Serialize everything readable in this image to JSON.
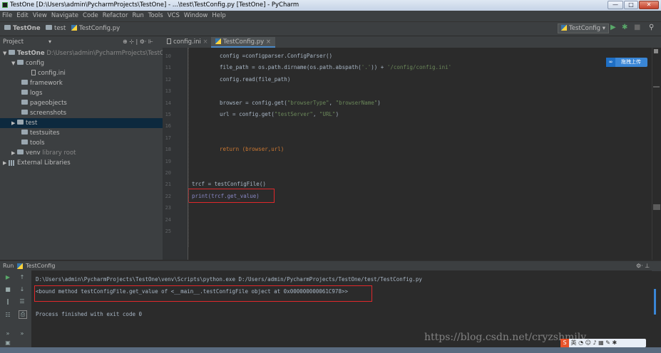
{
  "window": {
    "title": "TestOne [D:\\Users\\admin\\PycharmProjects\\TestOne] - ...\\test\\TestConfig.py [TestOne] - PyCharm",
    "min_label": "—",
    "max_label": "□",
    "close_label": "✕"
  },
  "menu": [
    "File",
    "Edit",
    "View",
    "Navigate",
    "Code",
    "Refactor",
    "Run",
    "Tools",
    "VCS",
    "Window",
    "Help"
  ],
  "navbar": {
    "crumbs": [
      "TestOne",
      "test",
      "TestConfig.py"
    ],
    "run_config": "TestConfig ▾",
    "run_icon": "▶",
    "debug_icon": "✱",
    "stop_icon": "■",
    "search_icon": "⚲"
  },
  "project_panel": {
    "title": "Project",
    "dropdown_icon": "▾",
    "tool_icons": "⊕ ⊹ | ⚙· ⊩",
    "tree": [
      {
        "label": "TestOne",
        "extra": "D:\\Users\\admin\\PycharmProjects\\TestOne",
        "arrow": "▼",
        "kind": "folder"
      },
      {
        "label": "config",
        "extra": "",
        "arrow": "▼",
        "kind": "folder"
      },
      {
        "label": "config.ini",
        "extra": "",
        "arrow": "",
        "kind": "ini"
      },
      {
        "label": "framework",
        "extra": "",
        "arrow": "",
        "kind": "folder"
      },
      {
        "label": "logs",
        "extra": "",
        "arrow": "",
        "kind": "folder"
      },
      {
        "label": "pageobjects",
        "extra": "",
        "arrow": "",
        "kind": "folder"
      },
      {
        "label": "screenshots",
        "extra": "",
        "arrow": "",
        "kind": "folder"
      },
      {
        "label": "test",
        "extra": "",
        "arrow": "▶",
        "kind": "folder"
      },
      {
        "label": "testsuites",
        "extra": "",
        "arrow": "",
        "kind": "folder"
      },
      {
        "label": "tools",
        "extra": "",
        "arrow": "",
        "kind": "folder"
      },
      {
        "label": "venv",
        "extra": "library root",
        "arrow": "▶",
        "kind": "folder"
      },
      {
        "label": "External Libraries",
        "extra": "",
        "arrow": "▶",
        "kind": "lib"
      }
    ]
  },
  "tabs": [
    {
      "label": "config.ini",
      "close": "×",
      "active": false
    },
    {
      "label": "TestConfig.py",
      "close": "×",
      "active": true
    }
  ],
  "editor": {
    "line_numbers": [
      "10",
      "11",
      "12",
      "13",
      "14",
      "15",
      "16",
      "17",
      "18",
      "19",
      "20",
      "21",
      "22",
      "23",
      "24",
      "25"
    ],
    "lines": [
      {
        "text": "config =configparser.ConfigParser()"
      },
      {
        "text": "file_path = os.path.dirname(os.path.abspath('.')) + '/config/config.ini'"
      },
      {
        "text": "config.read(file_path)"
      },
      {
        "text": ""
      },
      {
        "text": "browser = config.get(\"browserType\", \"browserName\")"
      },
      {
        "text": "url = config.get(\"testServer\", \"URL\")"
      },
      {
        "text": ""
      },
      {
        "text": ""
      },
      {
        "text": "return (browser,url)"
      },
      {
        "text": ""
      },
      {
        "text": ""
      },
      {
        "text": "trcf = testConfigFile()"
      },
      {
        "text": "print(trcf.get_value)"
      },
      {
        "text": ""
      },
      {
        "text": ""
      },
      {
        "text": ""
      }
    ],
    "cloud_button": "拖拽上传"
  },
  "run_panel": {
    "title": "Run",
    "config": "TestConfig",
    "settings_icon": "⚙· ⊥",
    "command": "D:\\Users\\admin\\PycharmProjects\\TestOne\\venv\\Scripts\\python.exe D:/Users/admin/PycharmProjects/TestOne/test/TestConfig.py",
    "output": "<bound method testConfigFile.get_value of <__main__.testConfigFile object at 0x000000000061C978>>",
    "exit": "Process finished with exit code 0"
  },
  "watermark": "https://blog.csdn.net/cryzshmily",
  "ime": "英"
}
